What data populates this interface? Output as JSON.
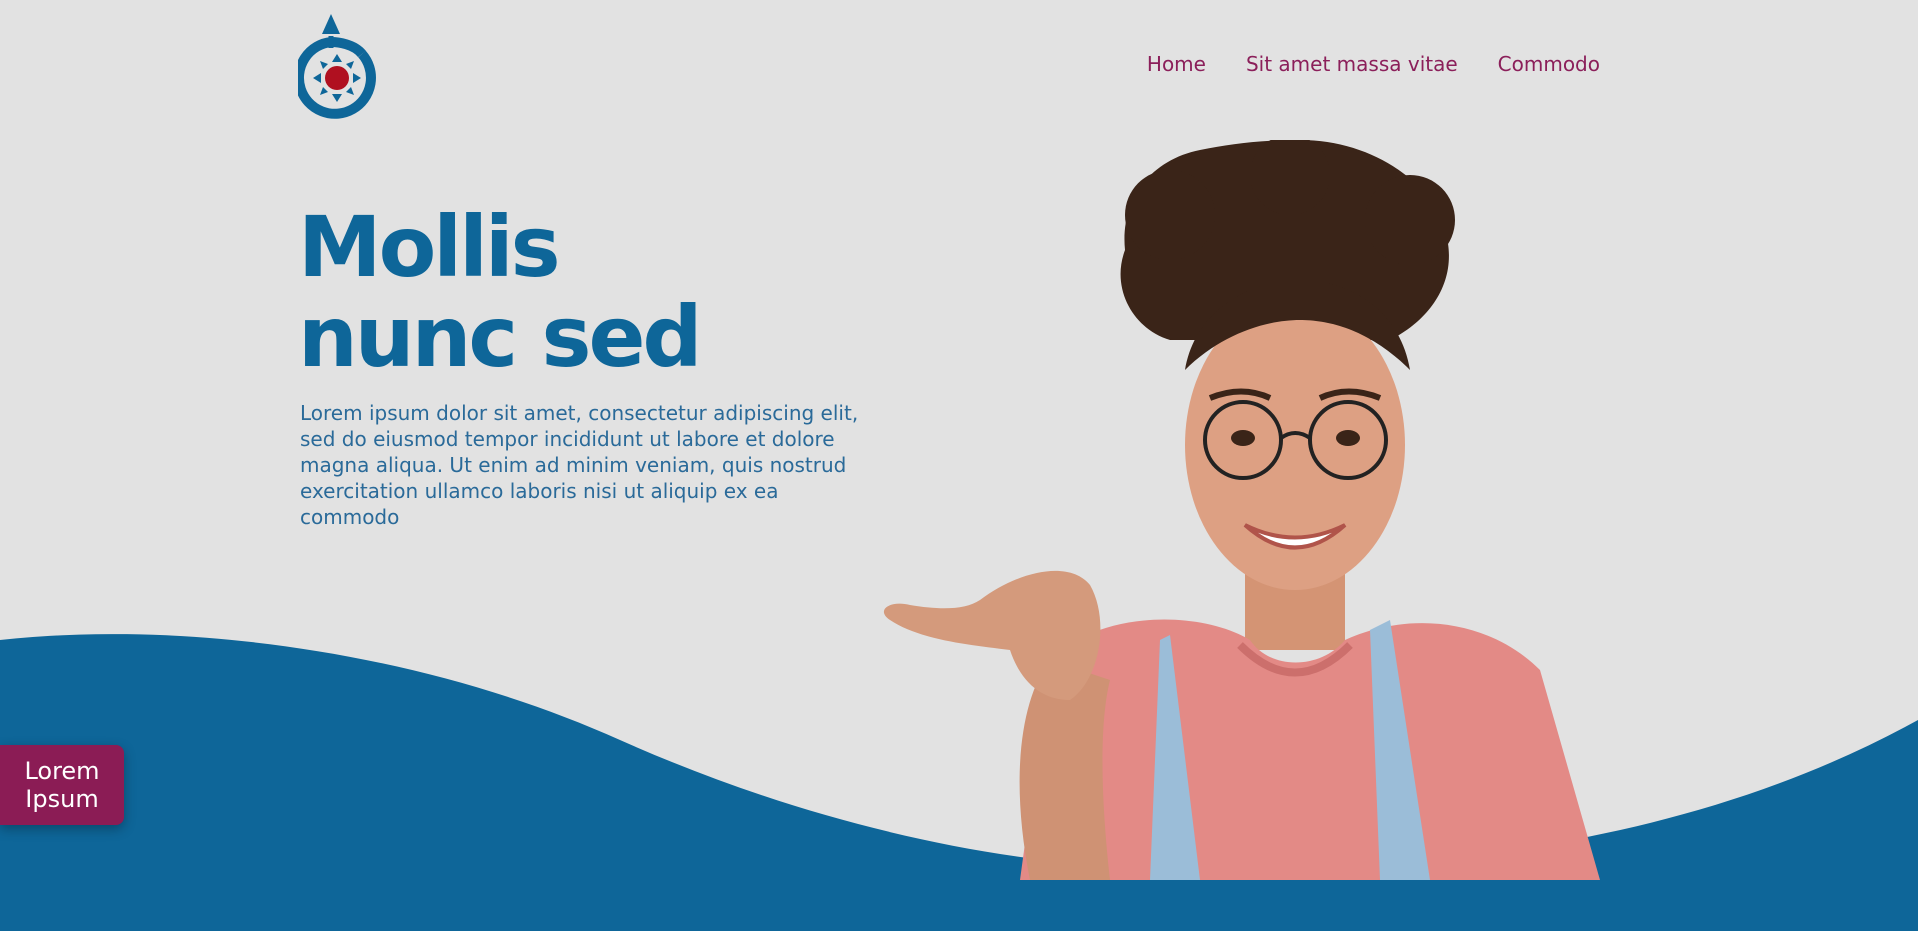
{
  "logo": {
    "icon": "commons-logo-icon"
  },
  "nav": {
    "items": [
      {
        "label": "Home"
      },
      {
        "label": "Sit amet massa vitae"
      },
      {
        "label": "Commodo"
      }
    ]
  },
  "hero": {
    "title_line1": "Mollis",
    "title_line2": "nunc sed",
    "body": "Lorem ipsum dolor sit amet, consectetur adipiscing elit, sed do eiusmod tempor incididunt ut labore et dolore magna aliqua. Ut enim ad minim veniam, quis nostrud exercitation ullamco laboris nisi ut aliquip ex ea commodo",
    "image": "woman-pointing-photo"
  },
  "badge": {
    "line1": "Lorem",
    "line2": "Ipsum"
  },
  "colors": {
    "background": "#e2e2e2",
    "primary_blue": "#0e6699",
    "accent_magenta": "#8b1c55",
    "logo_red": "#b01020"
  }
}
